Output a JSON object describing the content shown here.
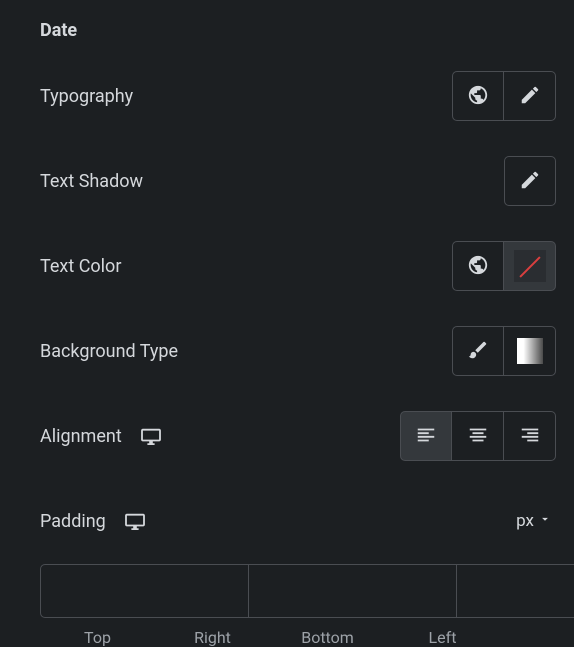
{
  "section": {
    "title": "Date"
  },
  "typography": {
    "label": "Typography"
  },
  "textShadow": {
    "label": "Text Shadow"
  },
  "textColor": {
    "label": "Text Color"
  },
  "backgroundType": {
    "label": "Background Type"
  },
  "alignment": {
    "label": "Alignment"
  },
  "padding": {
    "label": "Padding",
    "unit": "px",
    "sides": {
      "top": "Top",
      "right": "Right",
      "bottom": "Bottom",
      "left": "Left"
    }
  }
}
